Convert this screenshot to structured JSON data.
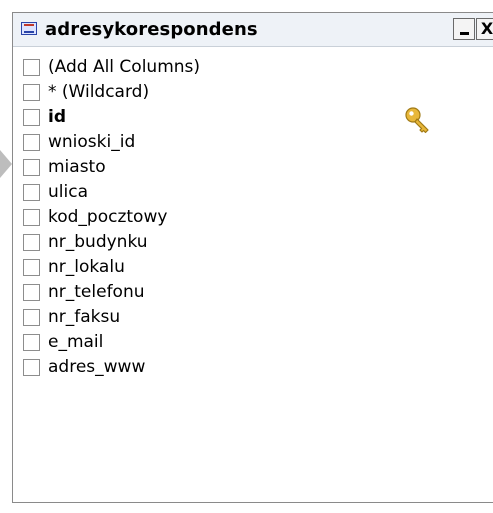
{
  "table": {
    "title": "adresykorespondens",
    "icon": "table-icon",
    "minimize_icon": "minimize-icon",
    "close_label": "X"
  },
  "columns": [
    {
      "label": "(Add All Columns)",
      "bold": false,
      "primary_key": false
    },
    {
      "label": "* (Wildcard)",
      "bold": false,
      "primary_key": false
    },
    {
      "label": "id",
      "bold": true,
      "primary_key": true
    },
    {
      "label": "wnioski_id",
      "bold": false,
      "primary_key": false
    },
    {
      "label": "miasto",
      "bold": false,
      "primary_key": false
    },
    {
      "label": "ulica",
      "bold": false,
      "primary_key": false
    },
    {
      "label": "kod_pocztowy",
      "bold": false,
      "primary_key": false
    },
    {
      "label": "nr_budynku",
      "bold": false,
      "primary_key": false
    },
    {
      "label": "nr_lokalu",
      "bold": false,
      "primary_key": false
    },
    {
      "label": "nr_telefonu",
      "bold": false,
      "primary_key": false
    },
    {
      "label": "nr_faksu",
      "bold": false,
      "primary_key": false
    },
    {
      "label": "e_mail",
      "bold": false,
      "primary_key": false
    },
    {
      "label": "adres_www",
      "bold": false,
      "primary_key": false
    }
  ],
  "colors": {
    "key": "#e8b73a",
    "border": "#8a8a8a",
    "title_bg": "#eef2f7"
  }
}
